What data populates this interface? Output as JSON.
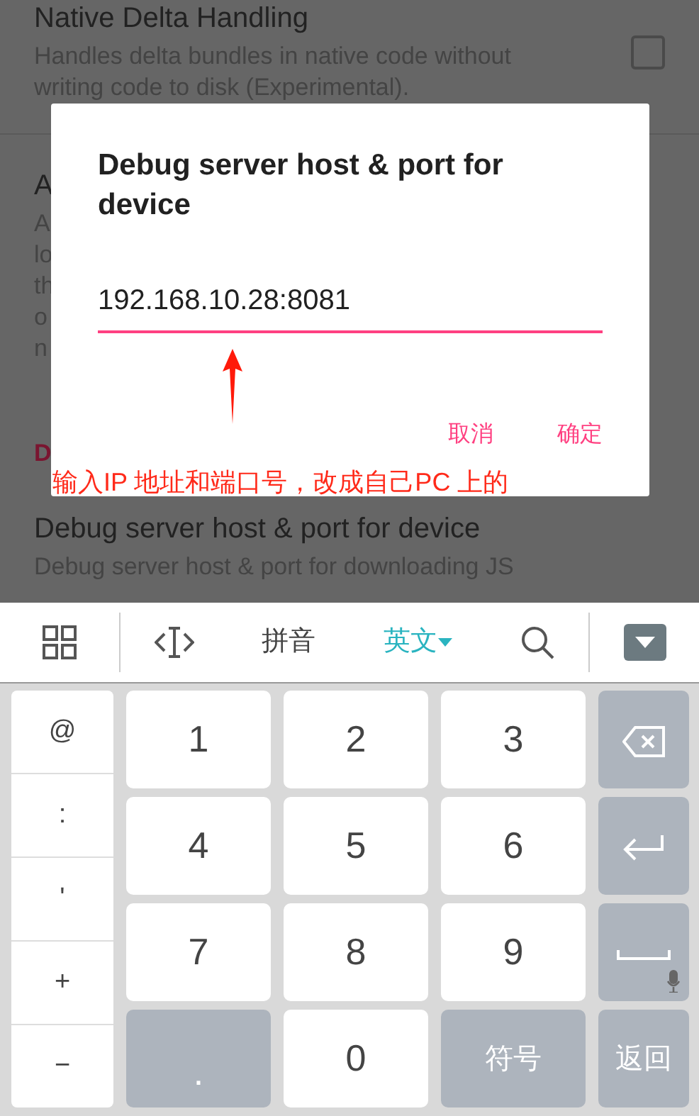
{
  "settings": [
    {
      "title": "Native Delta Handling",
      "summary": [
        "Handles delta bundles in native code without",
        "writing code to disk (Experimental)."
      ],
      "checked": false
    },
    {
      "title": "A",
      "summary": [
        "A",
        "lo",
        "th",
        "o",
        "n"
      ]
    }
  ],
  "category": "D",
  "setting_below": {
    "title": "Debug server host & port for device",
    "summary": [
      "Debug server host & port for downloading JS"
    ]
  },
  "dialog": {
    "title": "Debug server host & port for device",
    "value": "192.168.10.28:8081",
    "buttons": [
      "取消",
      "确定"
    ]
  },
  "annotation": "输入IP 地址和端口号，改成自己PC 上的",
  "keyboard": {
    "input_modes": [
      {
        "label": "拼音",
        "selected": false
      },
      {
        "label": "英文",
        "selected": true
      }
    ],
    "symbols": [
      "@",
      ":",
      "'",
      "+",
      "−"
    ],
    "keys": [
      {
        "kind": "light",
        "label": "1"
      },
      {
        "kind": "light",
        "label": "2"
      },
      {
        "kind": "light",
        "label": "3"
      },
      {
        "kind": "backspace"
      },
      {
        "kind": "light",
        "label": "4"
      },
      {
        "kind": "light",
        "label": "5"
      },
      {
        "kind": "light",
        "label": "6"
      },
      {
        "kind": "enter"
      },
      {
        "kind": "light",
        "label": "7"
      },
      {
        "kind": "light",
        "label": "8"
      },
      {
        "kind": "light",
        "label": "9"
      },
      {
        "kind": "space"
      },
      {
        "kind": "dark",
        "label": "."
      },
      {
        "kind": "light",
        "label": "0"
      },
      {
        "kind": "dark",
        "label": "符号"
      },
      {
        "kind": "dark",
        "label": "返回"
      }
    ]
  }
}
